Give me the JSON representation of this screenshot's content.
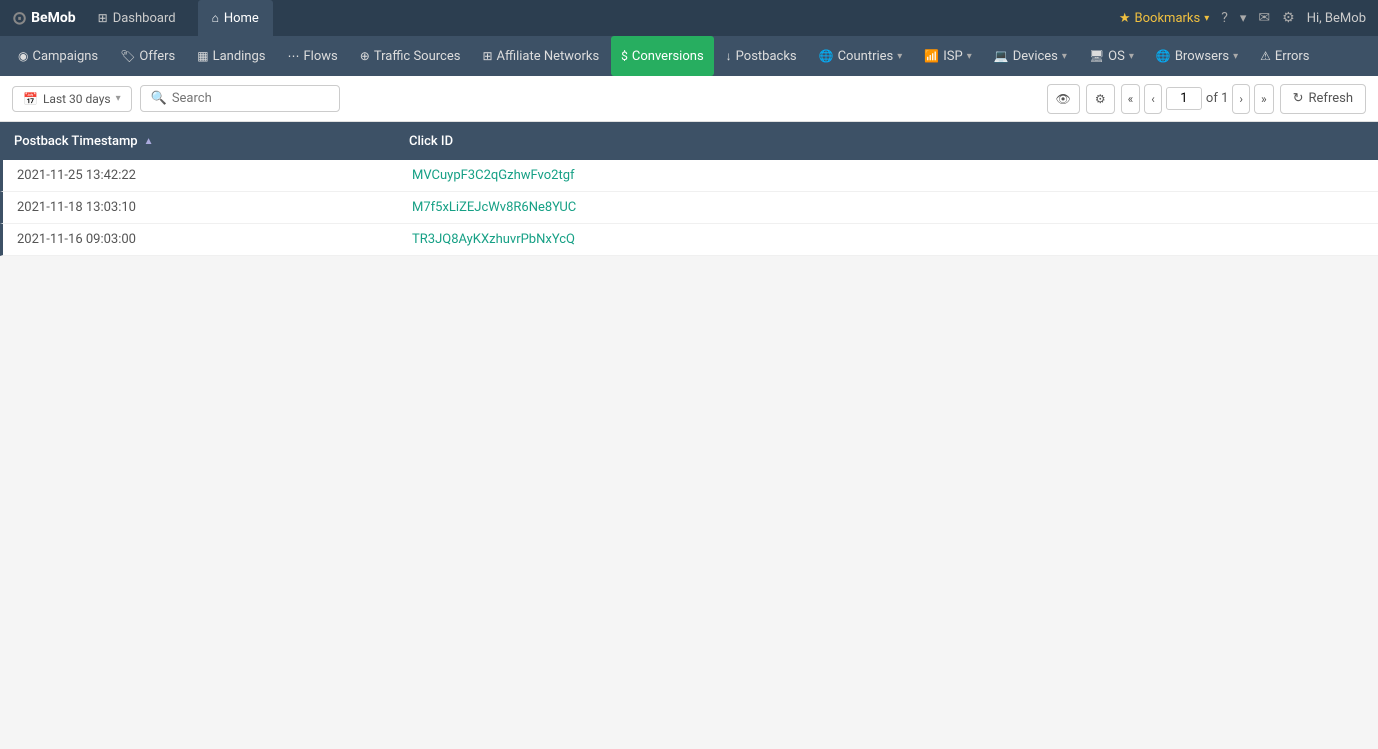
{
  "topbar": {
    "logo": "BeMob",
    "logo_icon": "⊙",
    "tabs": [
      {
        "label": "Dashboard",
        "icon": "⊞",
        "active": false
      },
      {
        "label": "Home",
        "icon": "⌂",
        "active": true
      }
    ],
    "bookmarks_label": "Bookmarks",
    "help_icon": "?",
    "notifications_icon": "🔔",
    "messages_icon": "✉",
    "settings_icon": "⚙",
    "user_label": "Hi, BeMob"
  },
  "navbar": {
    "items": [
      {
        "label": "Campaigns",
        "icon": "◉",
        "active": false,
        "has_chevron": false
      },
      {
        "label": "Offers",
        "icon": "🏷",
        "active": false,
        "has_chevron": false
      },
      {
        "label": "Landings",
        "icon": "▦",
        "active": false,
        "has_chevron": false
      },
      {
        "label": "Flows",
        "icon": "⋯",
        "active": false,
        "has_chevron": false
      },
      {
        "label": "Traffic Sources",
        "icon": "⊕",
        "active": false,
        "has_chevron": false
      },
      {
        "label": "Affiliate Networks",
        "icon": "⊞",
        "active": false,
        "has_chevron": false
      },
      {
        "label": "Conversions",
        "icon": "$",
        "active": true,
        "has_chevron": false
      },
      {
        "label": "Postbacks",
        "icon": "↓",
        "active": false,
        "has_chevron": false
      },
      {
        "label": "Countries",
        "icon": "🌐",
        "active": false,
        "has_chevron": true
      },
      {
        "label": "ISP",
        "icon": "📶",
        "active": false,
        "has_chevron": true
      },
      {
        "label": "Devices",
        "icon": "💻",
        "active": false,
        "has_chevron": true
      },
      {
        "label": "OS",
        "icon": "🖥",
        "active": false,
        "has_chevron": true
      },
      {
        "label": "Browsers",
        "icon": "🌐",
        "active": false,
        "has_chevron": true
      },
      {
        "label": "Errors",
        "icon": "⚠",
        "active": false,
        "has_chevron": false
      }
    ]
  },
  "toolbar": {
    "date_label": "Last 30 days",
    "search_placeholder": "Search",
    "page_current": "1",
    "page_of": "of 1",
    "refresh_label": "Refresh"
  },
  "table": {
    "columns": [
      {
        "label": "Postback Timestamp",
        "sortable": true
      },
      {
        "label": "Click ID",
        "sortable": false
      }
    ],
    "rows": [
      {
        "timestamp": "2021-11-25 13:42:22",
        "click_id": "MVCuypF3C2qGzhwFvo2tgf"
      },
      {
        "timestamp": "2021-11-18 13:03:10",
        "click_id": "M7f5xLiZEJcWv8R6Ne8YUC"
      },
      {
        "timestamp": "2021-11-16 09:03:00",
        "click_id": "TR3JQ8AyKXzhuvrPbNxYcQ"
      }
    ]
  }
}
